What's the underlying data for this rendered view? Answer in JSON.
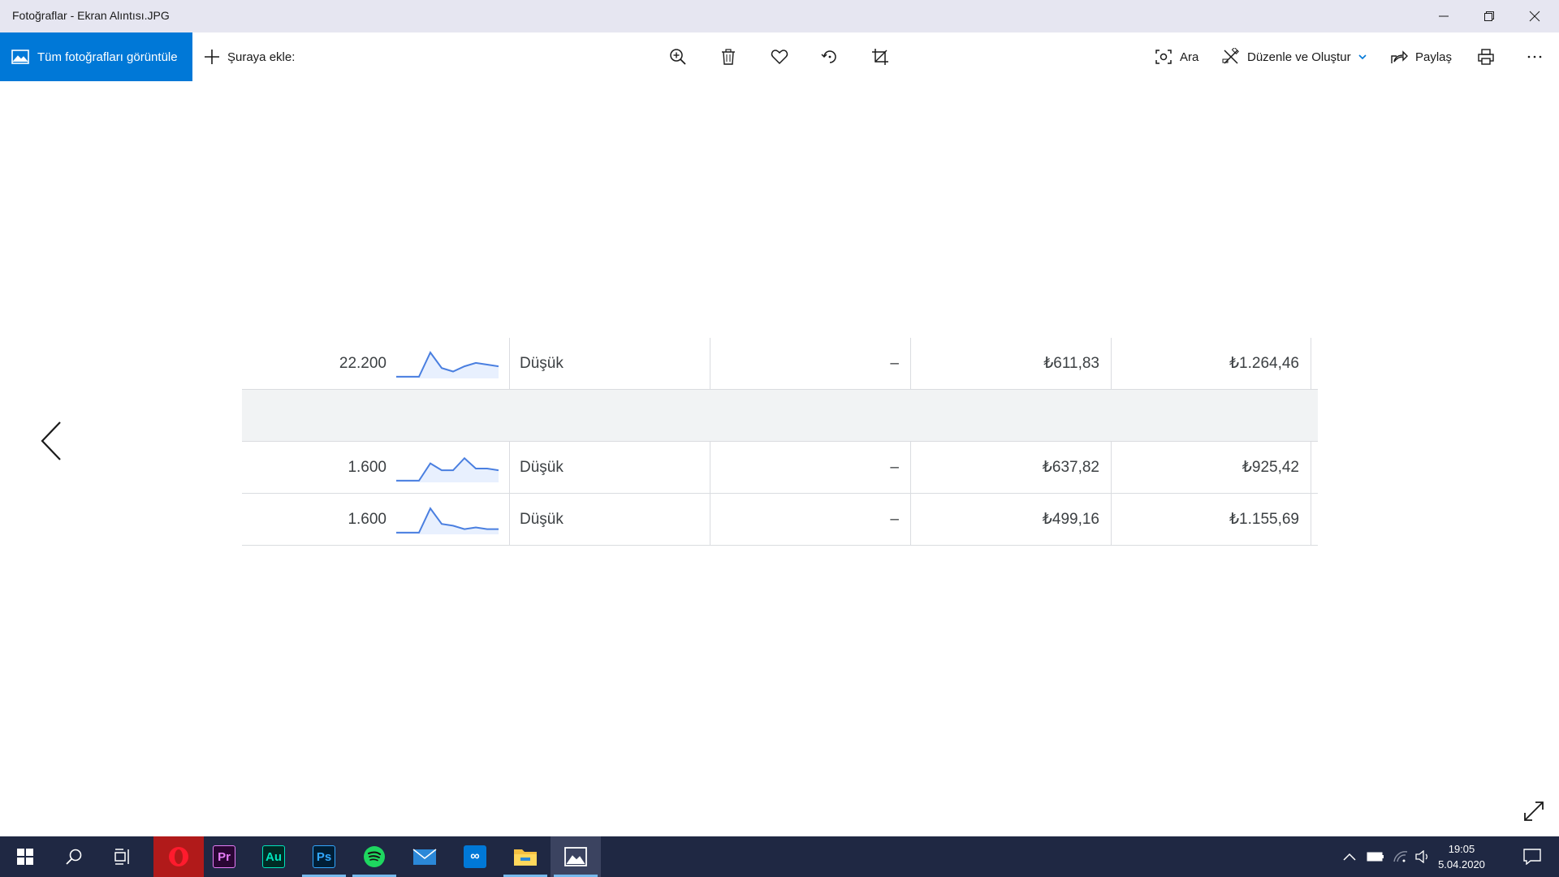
{
  "window": {
    "title": "Fotoğraflar - Ekran Alıntısı.JPG"
  },
  "toolbar": {
    "view_all_label": "Tüm fotoğrafları görüntüle",
    "add_to_label": "Şuraya ekle:",
    "search_label": "Ara",
    "edit_create_label": "Düzenle ve Oluştur",
    "share_label": "Paylaş"
  },
  "photo_table": {
    "rows": [
      {
        "volume": "22.200",
        "competition": "Düşük",
        "change": "–",
        "bid_low": "₺611,83",
        "bid_high": "₺1.264,46",
        "trend": [
          2,
          2,
          2,
          30,
          12,
          8,
          14,
          18,
          16,
          14
        ]
      },
      {
        "volume": "1.600",
        "competition": "Düşük",
        "change": "–",
        "bid_low": "₺637,82",
        "bid_high": "₺925,42",
        "trend": [
          2,
          2,
          2,
          22,
          14,
          14,
          28,
          16,
          16,
          14
        ]
      },
      {
        "volume": "1.600",
        "competition": "Düşük",
        "change": "–",
        "bid_low": "₺499,16",
        "bid_high": "₺1.155,69",
        "trend": [
          2,
          2,
          2,
          30,
          12,
          10,
          6,
          8,
          6,
          6
        ]
      }
    ]
  },
  "taskbar": {
    "apps": [
      {
        "name": "opera",
        "label": "",
        "color": "#cc1b1b"
      },
      {
        "name": "premiere",
        "label": "Pr",
        "color": "#e77cf7"
      },
      {
        "name": "audition",
        "label": "Au",
        "color": "#00e4bb"
      },
      {
        "name": "photoshop",
        "label": "Ps",
        "color": "#31a8ff"
      },
      {
        "name": "spotify",
        "label": "",
        "color": "#1ed760"
      },
      {
        "name": "mail",
        "label": "",
        "color": "#2b88d8"
      },
      {
        "name": "infinity",
        "label": "",
        "color": "#0078d7"
      },
      {
        "name": "file-explorer",
        "label": "",
        "color": "#f5c142"
      },
      {
        "name": "photos",
        "label": "",
        "color": "#ffffff"
      }
    ],
    "time": "19:05",
    "date": "5.04.2020"
  }
}
